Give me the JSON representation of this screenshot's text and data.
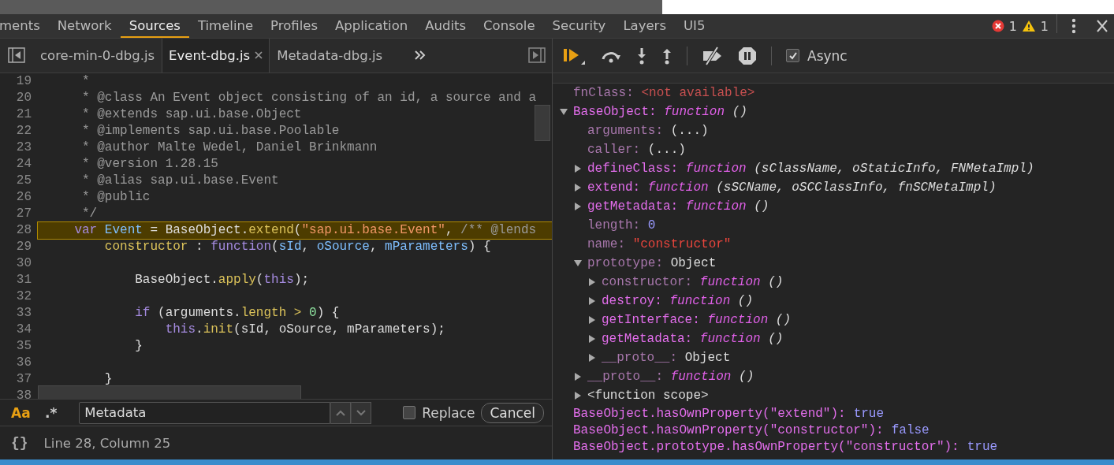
{
  "panel_tabs": [
    {
      "label": "ments",
      "selected": false
    },
    {
      "label": "Network",
      "selected": false
    },
    {
      "label": "Sources",
      "selected": true
    },
    {
      "label": "Timeline",
      "selected": false
    },
    {
      "label": "Profiles",
      "selected": false
    },
    {
      "label": "Application",
      "selected": false
    },
    {
      "label": "Audits",
      "selected": false
    },
    {
      "label": "Console",
      "selected": false
    },
    {
      "label": "Security",
      "selected": false
    },
    {
      "label": "Layers",
      "selected": false
    },
    {
      "label": "UI5",
      "selected": false
    }
  ],
  "error_count": "1",
  "warning_count": "1",
  "file_tabs": [
    {
      "label": "core-min-0-dbg.js",
      "selected": false,
      "closable": false
    },
    {
      "label": "Event-dbg.js",
      "selected": true,
      "closable": true
    },
    {
      "label": "Metadata-dbg.js",
      "selected": false,
      "closable": false
    }
  ],
  "code_lines": [
    {
      "number": "19",
      "highlighted": false,
      "tokens": [
        {
          "kind": "comment",
          "text": "     *"
        }
      ]
    },
    {
      "number": "20",
      "highlighted": false,
      "tokens": [
        {
          "kind": "comment",
          "text": "     * @class An Event object consisting of an id, a source and a"
        }
      ]
    },
    {
      "number": "21",
      "highlighted": false,
      "tokens": [
        {
          "kind": "comment",
          "text": "     * @extends sap.ui.base.Object"
        }
      ]
    },
    {
      "number": "22",
      "highlighted": false,
      "tokens": [
        {
          "kind": "comment",
          "text": "     * @implements sap.ui.base.Poolable"
        }
      ]
    },
    {
      "number": "23",
      "highlighted": false,
      "tokens": [
        {
          "kind": "comment",
          "text": "     * @author Malte Wedel, Daniel Brinkmann"
        }
      ]
    },
    {
      "number": "24",
      "highlighted": false,
      "tokens": [
        {
          "kind": "comment",
          "text": "     * @version 1.28.15"
        }
      ]
    },
    {
      "number": "25",
      "highlighted": false,
      "tokens": [
        {
          "kind": "comment",
          "text": "     * @alias sap.ui.base.Event"
        }
      ]
    },
    {
      "number": "26",
      "highlighted": false,
      "tokens": [
        {
          "kind": "comment",
          "text": "     * @public"
        }
      ]
    },
    {
      "number": "27",
      "highlighted": false,
      "tokens": [
        {
          "kind": "comment",
          "text": "     */"
        }
      ]
    },
    {
      "number": "28",
      "highlighted": true,
      "tokens": [
        {
          "kind": "keyword",
          "text": "    var"
        },
        {
          "kind": "name",
          "text": " Event"
        },
        {
          "kind": "plain",
          "text": " = BaseObject."
        },
        {
          "kind": "func",
          "text": "extend"
        },
        {
          "kind": "plain",
          "text": "("
        },
        {
          "kind": "string",
          "text": "\"sap.ui.base.Event\""
        },
        {
          "kind": "plain",
          "text": ", "
        },
        {
          "kind": "comment",
          "text": "/** @lends"
        }
      ]
    },
    {
      "number": "29",
      "highlighted": false,
      "tokens": [
        {
          "kind": "func",
          "text": "        constructor"
        },
        {
          "kind": "plain",
          "text": " : "
        },
        {
          "kind": "keyword",
          "text": "function"
        },
        {
          "kind": "plain",
          "text": "("
        },
        {
          "kind": "name",
          "text": "sId"
        },
        {
          "kind": "plain",
          "text": ", "
        },
        {
          "kind": "name",
          "text": "oSource"
        },
        {
          "kind": "plain",
          "text": ", "
        },
        {
          "kind": "name",
          "text": "mParameters"
        },
        {
          "kind": "plain",
          "text": ") {"
        }
      ]
    },
    {
      "number": "30",
      "highlighted": false
    },
    {
      "number": "31",
      "highlighted": false,
      "tokens": [
        {
          "kind": "plain",
          "text": "            BaseObject."
        },
        {
          "kind": "func",
          "text": "apply"
        },
        {
          "kind": "plain",
          "text": "("
        },
        {
          "kind": "keyword",
          "text": "this"
        },
        {
          "kind": "plain",
          "text": ");"
        }
      ]
    },
    {
      "number": "32",
      "highlighted": false
    },
    {
      "number": "33",
      "highlighted": false,
      "tokens": [
        {
          "kind": "keyword",
          "text": "            if"
        },
        {
          "kind": "plain",
          "text": " (arguments."
        },
        {
          "kind": "func",
          "text": "length"
        },
        {
          "kind": "func",
          "text": " >"
        },
        {
          "kind": "number",
          "text": " 0"
        },
        {
          "kind": "plain",
          "text": ") {"
        }
      ]
    },
    {
      "number": "34",
      "highlighted": false,
      "tokens": [
        {
          "kind": "keyword",
          "text": "                this"
        },
        {
          "kind": "plain",
          "text": "."
        },
        {
          "kind": "func",
          "text": "init"
        },
        {
          "kind": "plain",
          "text": "(sId, oSource, mParameters);"
        }
      ]
    },
    {
      "number": "35",
      "highlighted": false,
      "tokens": [
        {
          "kind": "plain",
          "text": "            }"
        }
      ]
    },
    {
      "number": "36",
      "highlighted": false
    },
    {
      "number": "37",
      "highlighted": false,
      "tokens": [
        {
          "kind": "plain",
          "text": "        }"
        }
      ]
    },
    {
      "number": "38",
      "highlighted": false
    }
  ],
  "search": {
    "case_label": "Aa",
    "regex_label": ".*",
    "value": "Metadata",
    "replace_checked": false,
    "replace_label": "Replace",
    "cancel_label": "Cancel"
  },
  "status": {
    "format_label": "{}",
    "position": "Line 28, Column 25"
  },
  "async": {
    "label": "Async",
    "checked": true
  },
  "watch": [
    {
      "name": "fnClass:",
      "enumerable": false,
      "value": {
        "kind": "unavailable",
        "text": "<not available>"
      }
    },
    {
      "name": "BaseObject:",
      "enumerable": true,
      "expanded": true,
      "value": {
        "kind": "function",
        "text": "function",
        "params": "()"
      },
      "children": [
        {
          "name": "arguments:",
          "enumerable": false,
          "value": {
            "kind": "plain",
            "text": "(...)"
          }
        },
        {
          "name": "caller:",
          "enumerable": false,
          "value": {
            "kind": "plain",
            "text": "(...)"
          }
        },
        {
          "name": "defineClass:",
          "enumerable": true,
          "expanded": false,
          "value": {
            "kind": "function",
            "text": "function",
            "params": "(sClassName, oStaticInfo, FNMetaImpl)"
          }
        },
        {
          "name": "extend:",
          "enumerable": true,
          "expanded": false,
          "value": {
            "kind": "function",
            "text": "function",
            "params": "(sSCName, oSCClassInfo, fnSCMetaImpl)"
          }
        },
        {
          "name": "getMetadata:",
          "enumerable": true,
          "expanded": false,
          "value": {
            "kind": "function",
            "text": "function",
            "params": "()"
          }
        },
        {
          "name": "length:",
          "enumerable": false,
          "value": {
            "kind": "number",
            "text": "0"
          }
        },
        {
          "name": "name:",
          "enumerable": false,
          "value": {
            "kind": "string",
            "text": "\"constructor\""
          }
        },
        {
          "name": "prototype:",
          "enumerable": false,
          "expanded": true,
          "value": {
            "kind": "plain",
            "text": "Object"
          },
          "children": [
            {
              "name": "constructor:",
              "enumerable": false,
              "expanded": false,
              "value": {
                "kind": "function",
                "text": "function",
                "params": "()"
              }
            },
            {
              "name": "destroy:",
              "enumerable": true,
              "expanded": false,
              "value": {
                "kind": "function",
                "text": "function",
                "params": "()"
              }
            },
            {
              "name": "getInterface:",
              "enumerable": true,
              "expanded": false,
              "value": {
                "kind": "function",
                "text": "function",
                "params": "()"
              }
            },
            {
              "name": "getMetadata:",
              "enumerable": true,
              "expanded": false,
              "value": {
                "kind": "function",
                "text": "function",
                "params": "()"
              }
            },
            {
              "name": "__proto__:",
              "enumerable": false,
              "expanded": false,
              "value": {
                "kind": "plain",
                "text": "Object"
              }
            }
          ]
        },
        {
          "name": "__proto__:",
          "enumerable": false,
          "expanded": false,
          "value": {
            "kind": "function",
            "text": "function",
            "params": "()"
          }
        },
        {
          "name": "<function scope>",
          "enumerable": false,
          "kind": "scope",
          "expanded": false
        }
      ]
    }
  ],
  "expressions": [
    {
      "expression": "BaseObject.hasOwnProperty(\"extend\"):",
      "value": "true"
    },
    {
      "expression": "BaseObject.hasOwnProperty(\"constructor\"):",
      "value": "false"
    },
    {
      "expression": "BaseObject.prototype.hasOwnProperty(\"constructor\"):",
      "value": "true"
    }
  ]
}
